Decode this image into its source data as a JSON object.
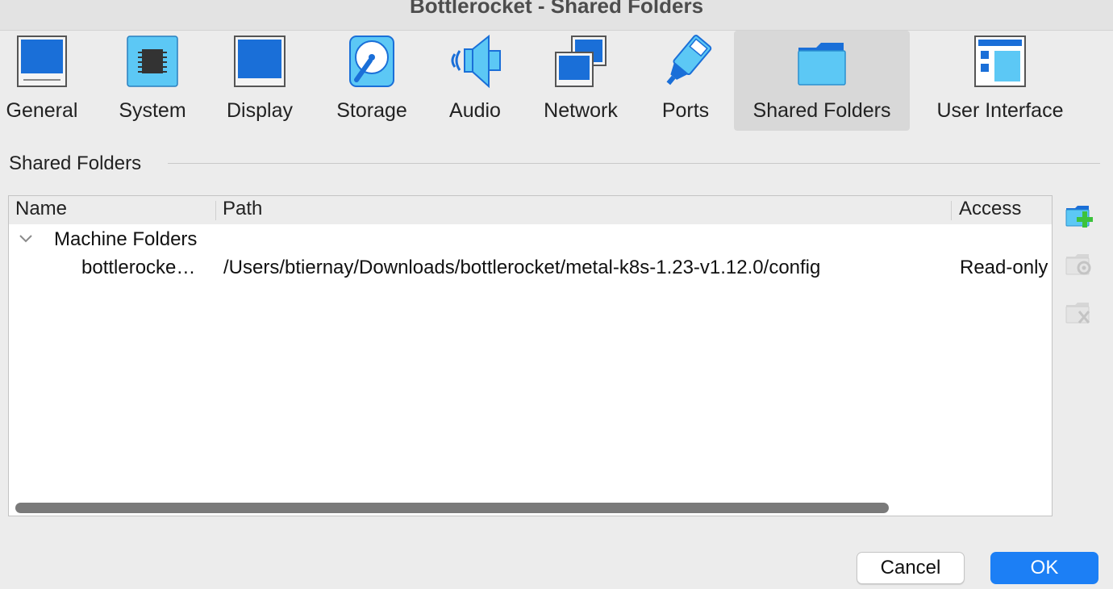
{
  "window": {
    "title": "Bottlerocket - Shared Folders"
  },
  "toolbar": {
    "items": [
      {
        "label": "General",
        "icon": "general-icon",
        "active": false
      },
      {
        "label": "System",
        "icon": "system-chip-icon",
        "active": false
      },
      {
        "label": "Display",
        "icon": "display-monitor-icon",
        "active": false
      },
      {
        "label": "Storage",
        "icon": "storage-disk-icon",
        "active": false
      },
      {
        "label": "Audio",
        "icon": "audio-speaker-icon",
        "active": false
      },
      {
        "label": "Network",
        "icon": "network-icon",
        "active": false
      },
      {
        "label": "Ports",
        "icon": "ports-plug-icon",
        "active": false
      },
      {
        "label": "Shared Folders",
        "icon": "shared-folder-icon",
        "active": true
      },
      {
        "label": "User Interface",
        "icon": "user-interface-icon",
        "active": false
      }
    ]
  },
  "section": {
    "title": "Shared Folders"
  },
  "table": {
    "columns": [
      "Name",
      "Path",
      "Access"
    ],
    "groups": [
      {
        "label": "Machine Folders",
        "expanded": true,
        "rows": [
          {
            "name": "bottlerocke…",
            "path": "/Users/btiernay/Downloads/bottlerocket/metal-k8s-1.23-v1.12.0/config",
            "access": "Read-only"
          }
        ]
      }
    ]
  },
  "side_actions": [
    {
      "name": "add-shared-folder",
      "icon": "add-folder-icon",
      "enabled": true
    },
    {
      "name": "edit-shared-folder",
      "icon": "edit-folder-icon",
      "enabled": false
    },
    {
      "name": "remove-shared-folder",
      "icon": "remove-folder-icon",
      "enabled": false
    }
  ],
  "buttons": {
    "cancel": "Cancel",
    "ok": "OK"
  },
  "colors": {
    "accent": "#1c7ff5",
    "icon_blue": "#1a6fd8",
    "icon_light": "#5cc8f5",
    "selected_tab": "#d8d8d8"
  }
}
